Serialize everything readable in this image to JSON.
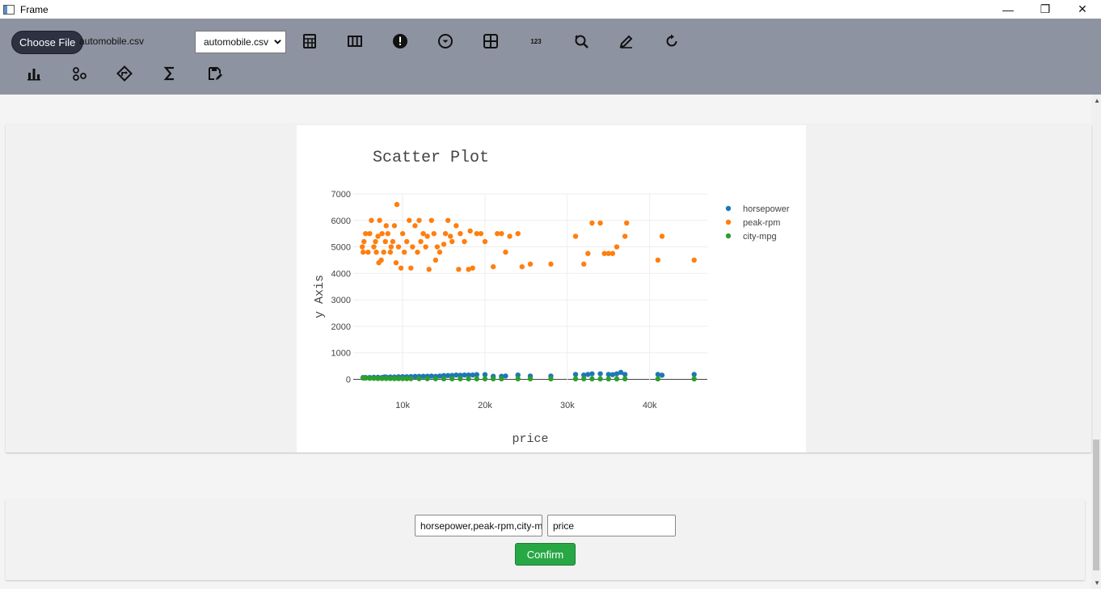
{
  "window": {
    "title": "Frame",
    "controls": [
      "minimize",
      "maximize",
      "close"
    ]
  },
  "toolbar": {
    "choose_file_label": "Choose File",
    "file_name": "automobile.csv",
    "dataset_select": {
      "selected": "automobile.csv"
    },
    "icons": [
      "table-icon",
      "columns-icon",
      "alert-icon",
      "dropdown-circle-icon",
      "grid-icon",
      "numbers-icon",
      "search-refresh-icon",
      "edit-icon",
      "refresh-icon",
      "bar-chart-icon",
      "scatter-icon",
      "diamond-arrow-icon",
      "sigma-icon",
      "save-edit-icon"
    ]
  },
  "chart_data": {
    "type": "scatter",
    "title": "Scatter Plot",
    "xlabel": "price",
    "ylabel": "y Axis",
    "xlim": [
      4000,
      47000
    ],
    "ylim": [
      -200,
      7000
    ],
    "x_ticks": [
      "10k",
      "20k",
      "30k",
      "40k"
    ],
    "y_ticks": [
      "0",
      "1000",
      "2000",
      "3000",
      "4000",
      "5000",
      "6000",
      "7000"
    ],
    "grid": true,
    "legend_position": "top-right",
    "series": [
      {
        "name": "horsepower",
        "color": "#1f77b4",
        "points": [
          [
            5200,
            70
          ],
          [
            5500,
            68
          ],
          [
            6000,
            70
          ],
          [
            6500,
            76
          ],
          [
            7000,
            76
          ],
          [
            7500,
            70
          ],
          [
            7800,
            86
          ],
          [
            8000,
            84
          ],
          [
            8500,
            88
          ],
          [
            9000,
            86
          ],
          [
            9500,
            95
          ],
          [
            10000,
            100
          ],
          [
            10500,
            97
          ],
          [
            11000,
            102
          ],
          [
            11500,
            110
          ],
          [
            12000,
            110
          ],
          [
            12500,
            114
          ],
          [
            13000,
            116
          ],
          [
            13500,
            121
          ],
          [
            14000,
            110
          ],
          [
            14500,
            123
          ],
          [
            15000,
            140
          ],
          [
            15500,
            140
          ],
          [
            16000,
            145
          ],
          [
            16500,
            160
          ],
          [
            17000,
            152
          ],
          [
            17500,
            160
          ],
          [
            18000,
            160
          ],
          [
            18500,
            161
          ],
          [
            19000,
            176
          ],
          [
            20000,
            176
          ],
          [
            21000,
            114
          ],
          [
            22000,
            114
          ],
          [
            22500,
            123
          ],
          [
            24000,
            160
          ],
          [
            25500,
            123
          ],
          [
            28000,
            123
          ],
          [
            31000,
            184
          ],
          [
            32000,
            160
          ],
          [
            32500,
            182
          ],
          [
            33000,
            207
          ],
          [
            34000,
            207
          ],
          [
            35000,
            182
          ],
          [
            35500,
            176
          ],
          [
            36000,
            207
          ],
          [
            36500,
            262
          ],
          [
            37000,
            184
          ],
          [
            41000,
            184
          ],
          [
            41500,
            155
          ],
          [
            45400,
            184
          ]
        ]
      },
      {
        "name": "peak-rpm",
        "color": "#ff7f0e",
        "points": [
          [
            5100,
            5000
          ],
          [
            5200,
            4800
          ],
          [
            5300,
            5200
          ],
          [
            5500,
            5500
          ],
          [
            5800,
            4800
          ],
          [
            6000,
            5500
          ],
          [
            6200,
            6000
          ],
          [
            6500,
            5000
          ],
          [
            6700,
            5200
          ],
          [
            6800,
            4800
          ],
          [
            7000,
            5400
          ],
          [
            7100,
            4400
          ],
          [
            7200,
            6000
          ],
          [
            7400,
            4500
          ],
          [
            7500,
            5500
          ],
          [
            7700,
            4800
          ],
          [
            7900,
            5200
          ],
          [
            8000,
            5800
          ],
          [
            8200,
            5500
          ],
          [
            8500,
            4800
          ],
          [
            8600,
            5000
          ],
          [
            8800,
            5200
          ],
          [
            9000,
            5800
          ],
          [
            9200,
            4400
          ],
          [
            9300,
            6600
          ],
          [
            9500,
            5000
          ],
          [
            9800,
            4200
          ],
          [
            10000,
            5500
          ],
          [
            10200,
            4800
          ],
          [
            10500,
            5200
          ],
          [
            10800,
            6000
          ],
          [
            11000,
            4200
          ],
          [
            11200,
            5000
          ],
          [
            11500,
            5800
          ],
          [
            11800,
            4800
          ],
          [
            12000,
            6000
          ],
          [
            12200,
            5200
          ],
          [
            12500,
            5500
          ],
          [
            12800,
            5000
          ],
          [
            13000,
            5400
          ],
          [
            13200,
            4150
          ],
          [
            13500,
            6000
          ],
          [
            13800,
            5500
          ],
          [
            14000,
            4500
          ],
          [
            14200,
            5000
          ],
          [
            14500,
            4800
          ],
          [
            15000,
            5100
          ],
          [
            15200,
            5500
          ],
          [
            15500,
            6000
          ],
          [
            15800,
            5400
          ],
          [
            16000,
            5200
          ],
          [
            16500,
            5800
          ],
          [
            16800,
            4150
          ],
          [
            17000,
            5500
          ],
          [
            17500,
            5200
          ],
          [
            18000,
            4150
          ],
          [
            18200,
            5600
          ],
          [
            18500,
            4200
          ],
          [
            19000,
            5500
          ],
          [
            19500,
            5500
          ],
          [
            20000,
            5200
          ],
          [
            21000,
            4250
          ],
          [
            21500,
            5500
          ],
          [
            22000,
            5500
          ],
          [
            22500,
            4800
          ],
          [
            23000,
            5400
          ],
          [
            24000,
            5500
          ],
          [
            24500,
            4250
          ],
          [
            25500,
            4350
          ],
          [
            28000,
            4350
          ],
          [
            31000,
            5400
          ],
          [
            32000,
            4350
          ],
          [
            32500,
            4750
          ],
          [
            33000,
            5900
          ],
          [
            34000,
            5900
          ],
          [
            34500,
            4750
          ],
          [
            35000,
            4750
          ],
          [
            35500,
            4750
          ],
          [
            36000,
            5000
          ],
          [
            37000,
            5400
          ],
          [
            37200,
            5900
          ],
          [
            41000,
            4500
          ],
          [
            41500,
            5400
          ],
          [
            45400,
            4500
          ]
        ]
      },
      {
        "name": "city-mpg",
        "color": "#2ca02c",
        "points": [
          [
            5200,
            47
          ],
          [
            5500,
            45
          ],
          [
            6000,
            38
          ],
          [
            6500,
            37
          ],
          [
            7000,
            31
          ],
          [
            7500,
            31
          ],
          [
            8000,
            31
          ],
          [
            8500,
            30
          ],
          [
            9000,
            27
          ],
          [
            9500,
            26
          ],
          [
            10000,
            26
          ],
          [
            10500,
            24
          ],
          [
            11000,
            24
          ],
          [
            12000,
            24
          ],
          [
            13000,
            23
          ],
          [
            14000,
            21
          ],
          [
            15000,
            19
          ],
          [
            16000,
            19
          ],
          [
            17000,
            19
          ],
          [
            18000,
            17
          ],
          [
            19000,
            17
          ],
          [
            20000,
            17
          ],
          [
            21000,
            19
          ],
          [
            22000,
            19
          ],
          [
            24000,
            17
          ],
          [
            25500,
            19
          ],
          [
            28000,
            17
          ],
          [
            31000,
            17
          ],
          [
            32000,
            16
          ],
          [
            33000,
            16
          ],
          [
            34000,
            15
          ],
          [
            35000,
            15
          ],
          [
            36000,
            14
          ],
          [
            37000,
            16
          ],
          [
            41000,
            14
          ],
          [
            45400,
            14
          ]
        ]
      }
    ]
  },
  "form": {
    "y_columns_value": "horsepower,peak-rpm,city-mpg",
    "x_column_value": "price",
    "confirm_label": "Confirm"
  }
}
